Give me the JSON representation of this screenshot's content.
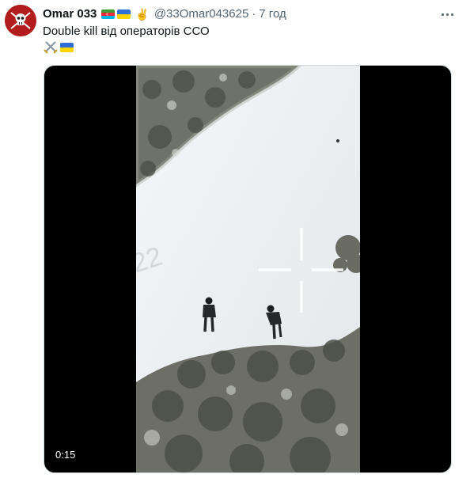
{
  "author": {
    "display_name": "Omar 033",
    "handle": "@33Omar043625",
    "separator": "·",
    "time": "7 год",
    "avatar_color": "#b31c1c",
    "name_icons": [
      "azerbaijan-flag-icon",
      "ukraine-flag-icon",
      "victory-hand-icon"
    ]
  },
  "tweet": {
    "text": "Double kill від операторів ССО",
    "emoji_icons": [
      "crossed-swords-icon",
      "ukraine-flag-icon"
    ]
  },
  "media": {
    "duration": "0:15",
    "watermark": "22"
  },
  "colors": {
    "text_primary": "#0f1419",
    "text_secondary": "#536471",
    "media_border": "#cfd9de"
  }
}
